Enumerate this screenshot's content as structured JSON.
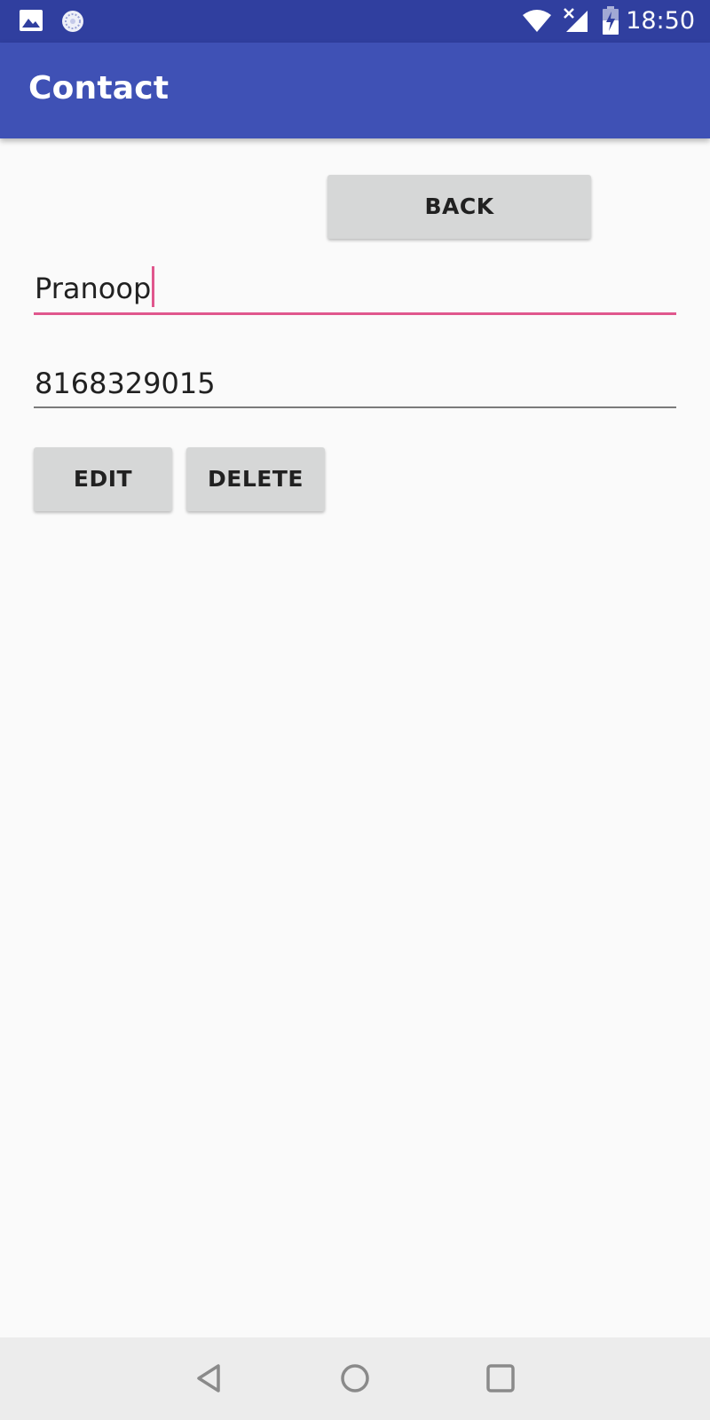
{
  "status_bar": {
    "time": "18:50",
    "icons": [
      "image-notification-icon",
      "sync-notification-icon",
      "wifi-icon",
      "no-signal-icon",
      "battery-charging-icon"
    ]
  },
  "app_bar": {
    "title": "Contact"
  },
  "buttons": {
    "back": "BACK",
    "edit": "EDIT",
    "delete": "DELETE"
  },
  "fields": {
    "name": {
      "value": "Pranoop",
      "focused": true
    },
    "phone": {
      "value": "8168329015"
    }
  },
  "nav_bar": {
    "icons": [
      "back-triangle-icon",
      "home-circle-icon",
      "recents-square-icon"
    ]
  },
  "colors": {
    "status_bar": "#303f9f",
    "app_bar": "#3f51b5",
    "accent": "#e0578d",
    "button": "#d6d7d7",
    "background": "#fafafa",
    "nav_bar": "#ececec"
  }
}
